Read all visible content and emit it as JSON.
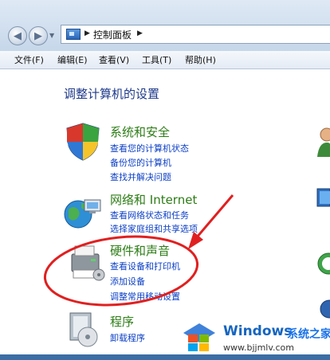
{
  "address_bar": {
    "breadcrumb": "控制面板"
  },
  "menu": [
    "文件(F)",
    "编辑(E)",
    "查看(V)",
    "工具(T)",
    "帮助(H)"
  ],
  "page_title": "调整计算机的设置",
  "categories": [
    {
      "title": "系统和安全",
      "links": [
        "查看您的计算机状态",
        "备份您的计算机",
        "查找并解决问题"
      ]
    },
    {
      "title": "网络和 Internet",
      "links": [
        "查看网络状态和任务",
        "选择家庭组和共享选项"
      ]
    },
    {
      "title": "硬件和声音",
      "links": [
        "查看设备和打印机",
        "添加设备",
        "调整常用移动设置"
      ]
    },
    {
      "title": "程序",
      "links": [
        "卸载程序"
      ]
    }
  ],
  "watermark": {
    "brand": "Windows",
    "subtitle": "系统之家",
    "url": "www.bjjmlv.com"
  },
  "colors": {
    "category_title": "#2d7d16",
    "link": "#0b3fc6",
    "annotation": "#e02020",
    "page_title": "#1e3a8a"
  }
}
